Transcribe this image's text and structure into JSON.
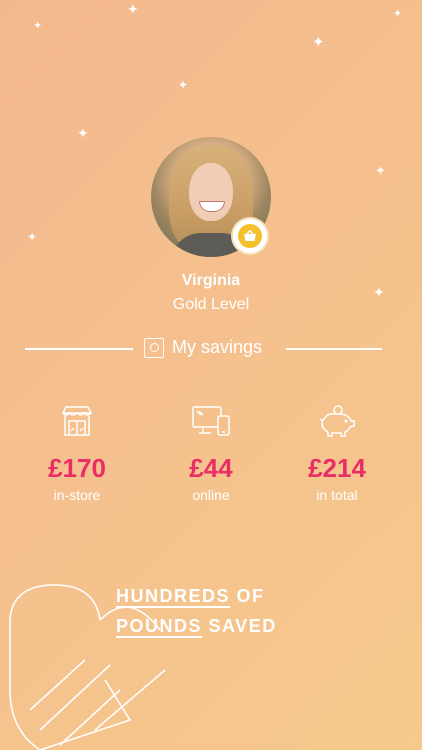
{
  "profile": {
    "name": "Virginia",
    "level": "Gold Level"
  },
  "savings_header": {
    "label": "My savings",
    "icon": "safe-icon"
  },
  "stats": [
    {
      "icon": "storefront-icon",
      "value": "£170",
      "label": "in-store"
    },
    {
      "icon": "devices-icon",
      "value": "£44",
      "label": "online"
    },
    {
      "icon": "piggy-bank-icon",
      "value": "£214",
      "label": "in total"
    }
  ],
  "promo": {
    "line1_underlined": "HUNDREDS",
    "line1_rest": " OF",
    "line2_underlined": "POUNDS",
    "line2_rest": " SAVED"
  },
  "colors": {
    "accent": "#e92e66",
    "badge": "#f4c12d",
    "background_start": "#f3b98e",
    "background_end": "#f6c98c"
  }
}
